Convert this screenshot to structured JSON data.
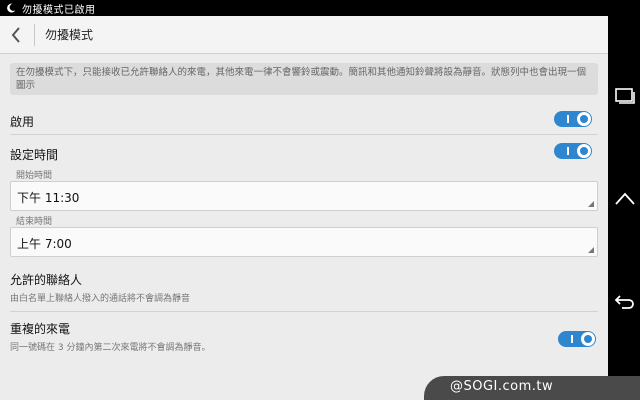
{
  "status_bar": {
    "text": "勿擾模式已啟用"
  },
  "app_bar": {
    "title": "勿擾模式"
  },
  "notice": {
    "text": "在勿擾模式下，只能接收已允許聯絡人的來電，其他來電一律不會響鈴或震動。簡訊和其他通知鈴聲將設為靜音。狀態列中也會出現一個圖示"
  },
  "enable": {
    "label": "啟用",
    "on": true
  },
  "schedule": {
    "label": "設定時間",
    "on": true
  },
  "start_time": {
    "label": "開始時間",
    "value": "下午 11:30"
  },
  "end_time": {
    "label": "結束時間",
    "value": "上午 7:00"
  },
  "allowed_contacts": {
    "label": "允許的聯絡人",
    "sub": "由白名單上聯絡人撥入的通話將不會調為靜音"
  },
  "repeat_callers": {
    "label": "重複的來電",
    "sub": "同一號碼在 3 分鐘內第二次來電將不會調為靜音。",
    "on": true
  },
  "watermark": {
    "text": "@SOGI.com.tw"
  },
  "colors": {
    "accent": "#2f86cf",
    "background": "#ececec"
  }
}
